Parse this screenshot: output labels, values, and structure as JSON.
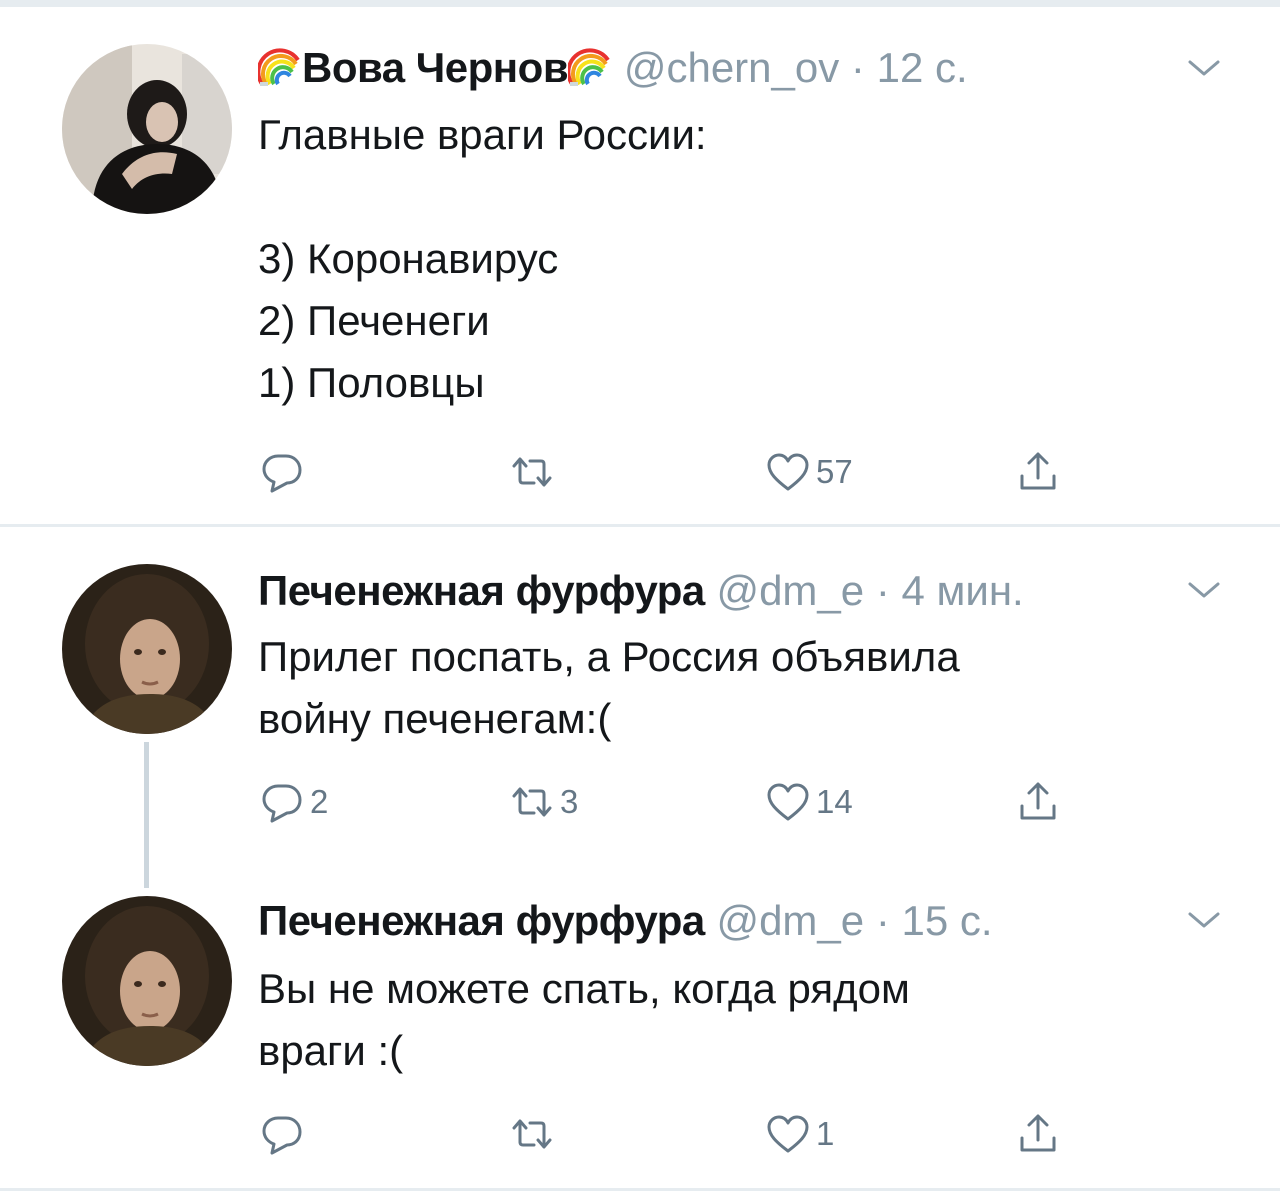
{
  "tweets": [
    {
      "name": "Вова Чернов",
      "name_prefix_icon": "rainbow-icon",
      "name_suffix_icon": "rainbow-icon",
      "handle": "@chern_ov",
      "dot": "·",
      "time": "12 с.",
      "lines": [
        "Главные враги России:",
        "",
        "3) Коронавирус",
        "2) Печенеги",
        "1) Половцы"
      ],
      "actions": {
        "reply_count": "",
        "retweet_count": "",
        "like_count": "57"
      }
    },
    {
      "name": "Печенежная фурфура",
      "handle": "@dm_e",
      "dot": "·",
      "time": "4 мин.",
      "lines": [
        "Прилег поспать, а Россия объявила",
        "войну печенегам:("
      ],
      "actions": {
        "reply_count": "2",
        "retweet_count": "3",
        "like_count": "14"
      }
    },
    {
      "name": "Печенежная фурфура",
      "handle": "@dm_e",
      "dot": "·",
      "time": "15 с.",
      "lines": [
        "Вы не можете спать, когда рядом",
        "враги :("
      ],
      "actions": {
        "reply_count": "",
        "retweet_count": "",
        "like_count": "1"
      }
    }
  ],
  "colors": {
    "text": "#14171a",
    "secondary": "#8899a6",
    "icon": "#657786",
    "border": "#e6ecf0",
    "thread_line": "#ccd6dd"
  },
  "icons": [
    "reply-icon",
    "retweet-icon",
    "like-icon",
    "share-icon",
    "chevron-down-icon",
    "rainbow-icon"
  ]
}
